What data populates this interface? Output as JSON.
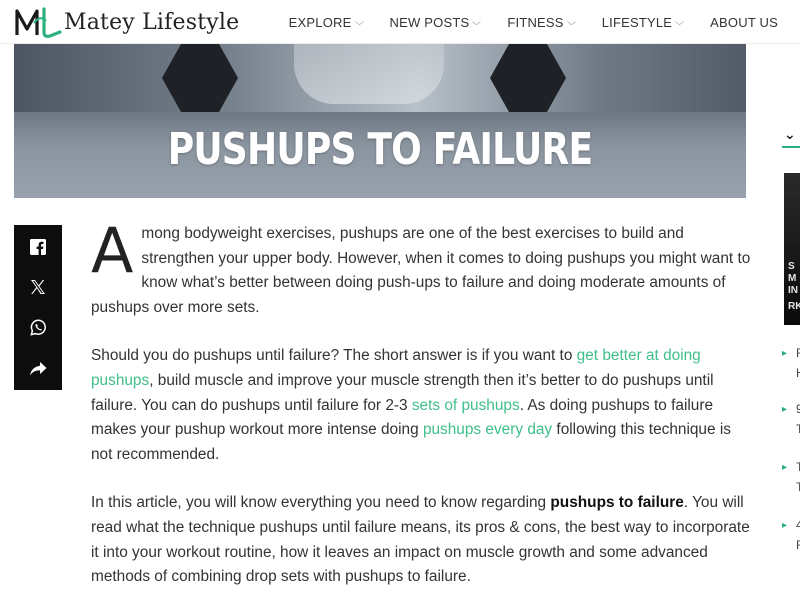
{
  "site": {
    "name": "Matey Lifestyle",
    "brand_color": "#2bb07e"
  },
  "nav": {
    "items": [
      {
        "label": "EXPLORE",
        "has_dropdown": true
      },
      {
        "label": "NEW POSTS",
        "has_dropdown": true
      },
      {
        "label": "FITNESS",
        "has_dropdown": true
      },
      {
        "label": "LIFESTYLE",
        "has_dropdown": true
      },
      {
        "label": "ABOUT US",
        "has_dropdown": false
      }
    ],
    "chevron": "⌵"
  },
  "hero": {
    "title": "PUSHUPS TO FAILURE"
  },
  "share": {
    "buttons": [
      "facebook-icon",
      "x-icon",
      "whatsapp-icon",
      "share-icon"
    ]
  },
  "article": {
    "p1": {
      "dropcap": "A",
      "text": "mong bodyweight exercises, pushups are one of the best exercises to build and strengthen your upper body. However, when it comes to doing pushups you might want to know what’s better between doing push-ups to failure and doing moderate amounts of pushups over more sets."
    },
    "p2": {
      "t1": "Should you do pushups until failure? The short answer is if you want to ",
      "link1": "get better at doing pushups",
      "t2": ", build muscle and improve your muscle strength then it’s better to do pushups until failure. You can do pushups until failure for 2-3 ",
      "link2": "sets of pushups",
      "t3": ". As doing pushups to failure makes your pushup workout more intense doing ",
      "link3": "pushups every day",
      "t4": " following this technique is not recommended."
    },
    "p3": {
      "t1": "In this article, you will know everything you need to know regarding ",
      "bold": "pushups to failure",
      "t2": ". You will read what the technique pushups until failure means, its pros & cons, the best way to incorporate it into your workout routine, how it leaves an impact on muscle growth and some advanced methods of combining drop sets with pushups to failure."
    },
    "link_color": "#3fbf8a"
  },
  "sidebar": {
    "chevron": "⌄",
    "thumb_letters": [
      "S",
      "M",
      "IN",
      "RK"
    ],
    "items": [
      {
        "l1": "F",
        "l2": "H"
      },
      {
        "l1": "9",
        "l2": "T"
      },
      {
        "l1": "T",
        "l2": "T"
      },
      {
        "l1": "4",
        "l2": "F"
      }
    ]
  }
}
